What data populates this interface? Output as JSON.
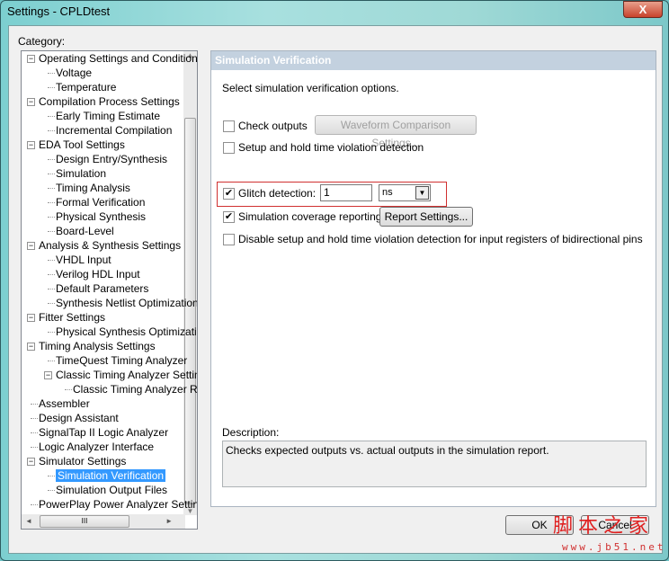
{
  "window": {
    "title": "Settings - CPLDtest",
    "close_label": "X"
  },
  "category_label": "Category:",
  "tree": [
    {
      "label": "Operating Settings and Conditions",
      "level": 0,
      "expander": true
    },
    {
      "label": "Voltage",
      "level": 1
    },
    {
      "label": "Temperature",
      "level": 1
    },
    {
      "label": "Compilation Process Settings",
      "level": 0,
      "expander": true
    },
    {
      "label": "Early Timing Estimate",
      "level": 1
    },
    {
      "label": "Incremental Compilation",
      "level": 1
    },
    {
      "label": "EDA Tool Settings",
      "level": 0,
      "expander": true
    },
    {
      "label": "Design Entry/Synthesis",
      "level": 1
    },
    {
      "label": "Simulation",
      "level": 1
    },
    {
      "label": "Timing Analysis",
      "level": 1
    },
    {
      "label": "Formal Verification",
      "level": 1
    },
    {
      "label": "Physical Synthesis",
      "level": 1
    },
    {
      "label": "Board-Level",
      "level": 1
    },
    {
      "label": "Analysis & Synthesis Settings",
      "level": 0,
      "expander": true
    },
    {
      "label": "VHDL Input",
      "level": 1
    },
    {
      "label": "Verilog HDL Input",
      "level": 1
    },
    {
      "label": "Default Parameters",
      "level": 1
    },
    {
      "label": "Synthesis Netlist Optimizations",
      "level": 1
    },
    {
      "label": "Fitter Settings",
      "level": 0,
      "expander": true
    },
    {
      "label": "Physical Synthesis Optimizations",
      "level": 1
    },
    {
      "label": "Timing Analysis Settings",
      "level": 0,
      "expander": true
    },
    {
      "label": "TimeQuest Timing Analyzer",
      "level": 1
    },
    {
      "label": "Classic Timing Analyzer Settings",
      "level": 1,
      "expander": true
    },
    {
      "label": "Classic Timing Analyzer Reports",
      "level": 2
    },
    {
      "label": "Assembler",
      "level": 0
    },
    {
      "label": "Design Assistant",
      "level": 0
    },
    {
      "label": "SignalTap II Logic Analyzer",
      "level": 0
    },
    {
      "label": "Logic Analyzer Interface",
      "level": 0
    },
    {
      "label": "Simulator Settings",
      "level": 0,
      "expander": true
    },
    {
      "label": "Simulation Verification",
      "level": 1,
      "selected": true
    },
    {
      "label": "Simulation Output Files",
      "level": 1
    },
    {
      "label": "PowerPlay Power Analyzer Settings",
      "level": 0
    }
  ],
  "panel": {
    "title": "Simulation Verification",
    "intro": "Select simulation verification options.",
    "check_outputs": {
      "label": "Check outputs",
      "checked": false
    },
    "waveform_button": "Waveform Comparison Settings...",
    "setup_hold": {
      "label": "Setup and hold time violation detection",
      "checked": false
    },
    "glitch": {
      "label": "Glitch detection:",
      "checked": true,
      "value": "1",
      "unit": "ns"
    },
    "coverage": {
      "label": "Simulation coverage reporting",
      "checked": true
    },
    "report_button": "Report Settings...",
    "disable_bidir": {
      "label": "Disable setup and hold time violation detection for input registers of bidirectional pins",
      "checked": false
    },
    "description_label": "Description:",
    "description": "Checks expected outputs vs. actual outputs in the simulation report."
  },
  "buttons": {
    "ok": "OK",
    "cancel": "Cancel"
  },
  "watermark": {
    "text": "脚本之家",
    "url": "www.jb51.net"
  }
}
